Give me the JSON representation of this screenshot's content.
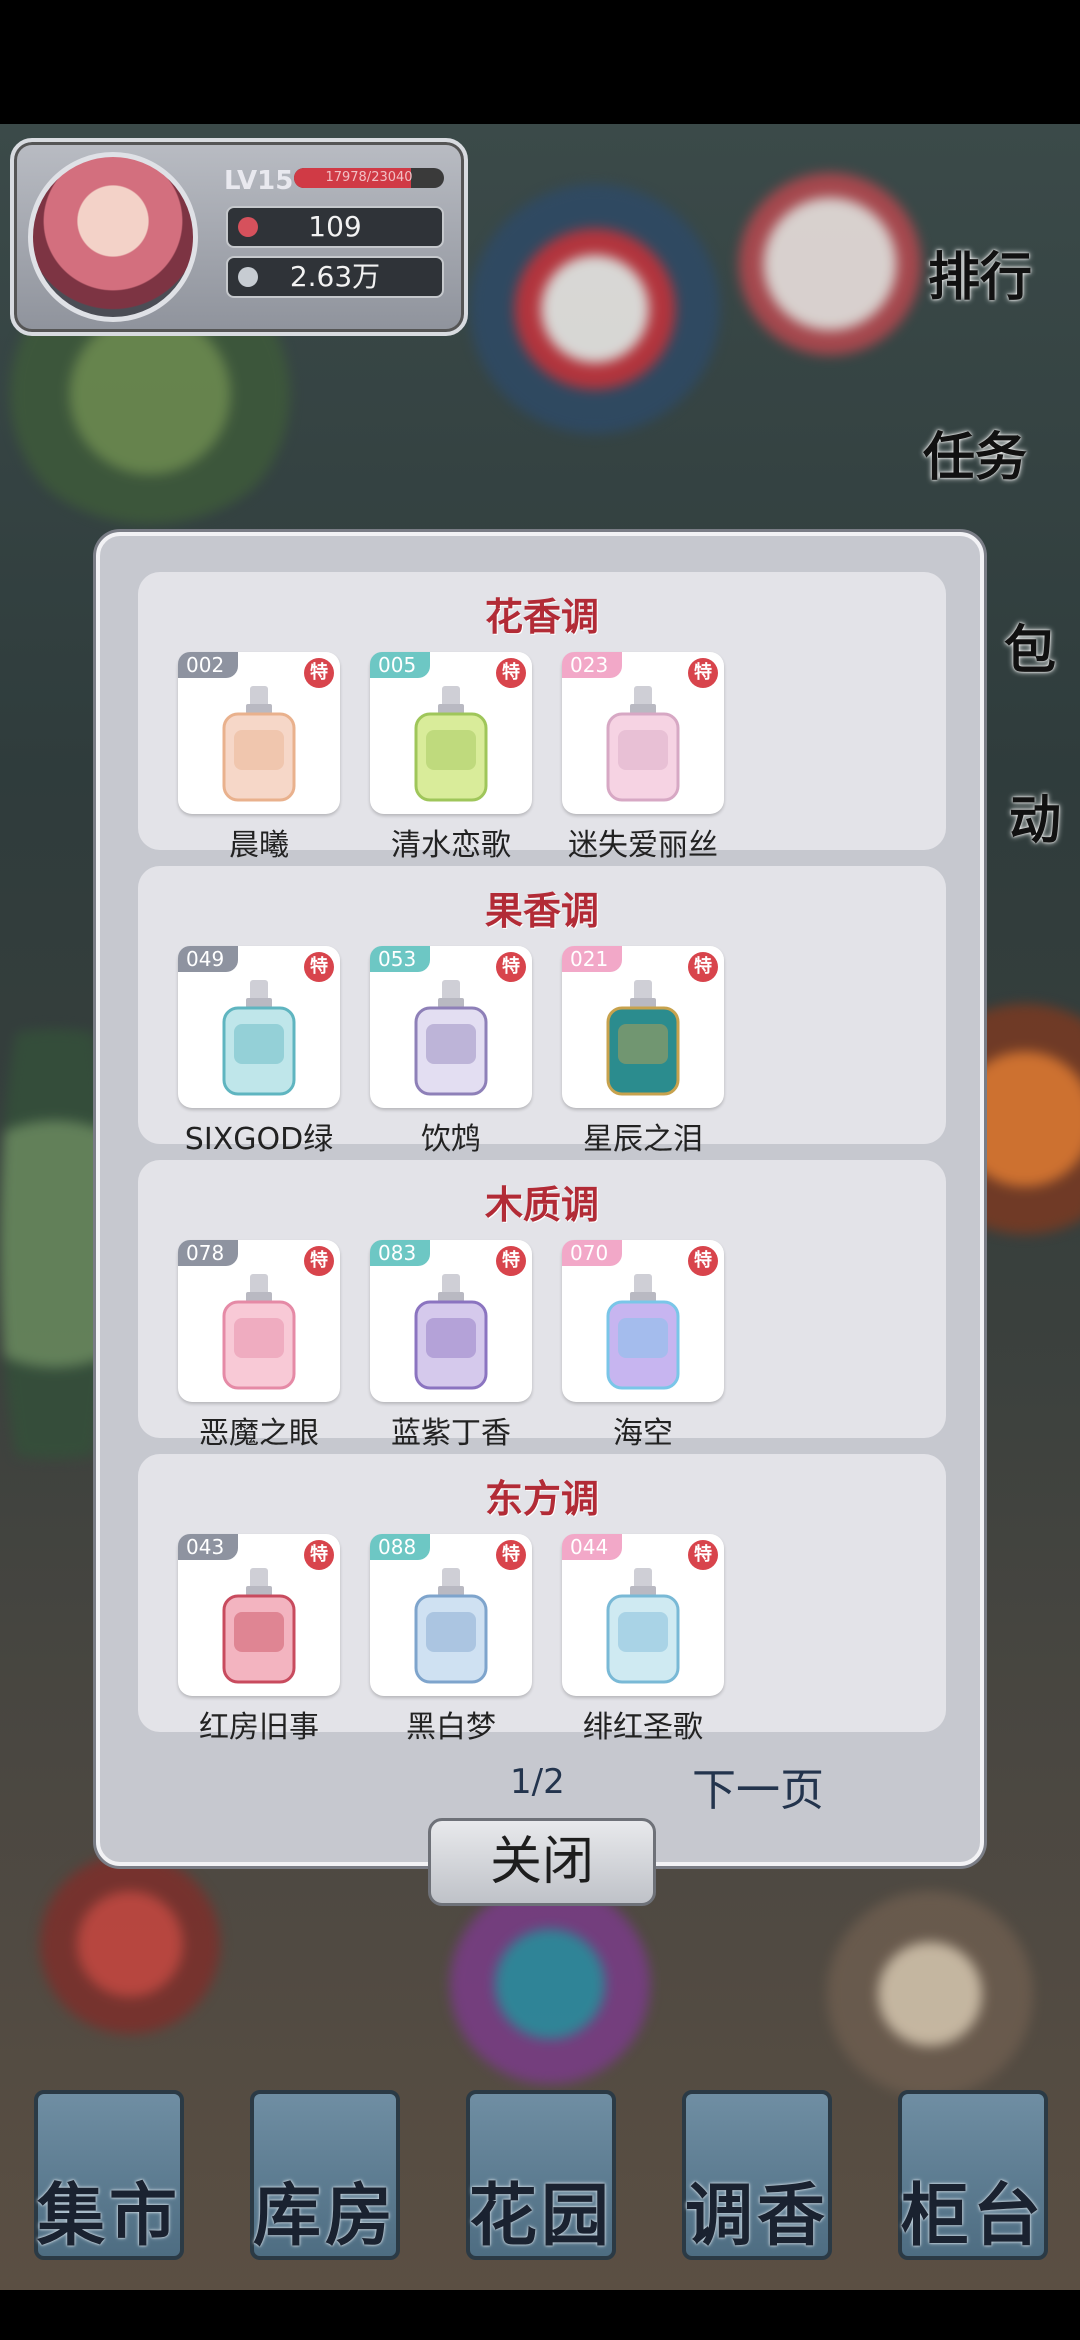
{
  "player": {
    "level": "LV15",
    "xp_text": "17978/23040",
    "xp_fraction": 0.78,
    "currency1": "109",
    "currency2": "2.63万"
  },
  "side_menu": [
    "排行",
    "任务",
    "包",
    "动"
  ],
  "modal": {
    "sections": [
      {
        "title": "花香调",
        "items": [
          {
            "num": "002",
            "name": "晨曦",
            "badge": "特",
            "tag_color": "#8e93a0"
          },
          {
            "num": "005",
            "name": "清水恋歌",
            "badge": "特",
            "tag_color": "#6dc7c4"
          },
          {
            "num": "023",
            "name": "迷失爱丽丝",
            "badge": "特",
            "tag_color": "#f2a8c8"
          }
        ]
      },
      {
        "title": "果香调",
        "items": [
          {
            "num": "049",
            "name": "SIXGOD绿",
            "badge": "特",
            "tag_color": "#8e93a0"
          },
          {
            "num": "053",
            "name": "饮鸩",
            "badge": "特",
            "tag_color": "#6dc7c4"
          },
          {
            "num": "021",
            "name": "星辰之泪",
            "badge": "特",
            "tag_color": "#f2a8c8"
          }
        ]
      },
      {
        "title": "木质调",
        "items": [
          {
            "num": "078",
            "name": "恶魔之眼",
            "badge": "特",
            "tag_color": "#8e93a0"
          },
          {
            "num": "083",
            "name": "蓝紫丁香",
            "badge": "特",
            "tag_color": "#6dc7c4"
          },
          {
            "num": "070",
            "name": "海空",
            "badge": "特",
            "tag_color": "#f2a8c8"
          }
        ]
      },
      {
        "title": "东方调",
        "items": [
          {
            "num": "043",
            "name": "红房旧事",
            "badge": "特",
            "tag_color": "#8e93a0"
          },
          {
            "num": "088",
            "name": "黑白梦",
            "badge": "特",
            "tag_color": "#6dc7c4"
          },
          {
            "num": "044",
            "name": "绯红圣歌",
            "badge": "特",
            "tag_color": "#f2a8c8"
          }
        ]
      }
    ],
    "page": "1/2",
    "next_label": "下一页",
    "close_label": "关闭"
  },
  "bottom_nav": [
    "集市",
    "库房",
    "花园",
    "调香",
    "柜台"
  ]
}
